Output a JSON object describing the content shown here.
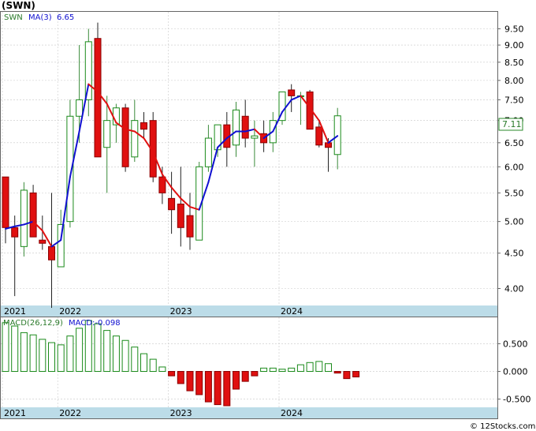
{
  "header": {
    "symbol": "(SWN)"
  },
  "price_legend": {
    "symbol": "SWN",
    "ma_label": "MA(3)",
    "ma_value": "6.65"
  },
  "macd_legend": {
    "label": "MACD(26,12,9)",
    "value_label": "MACD:-0.098"
  },
  "last_price_badge": "7.11",
  "watermark": "© 12Stocks.com",
  "colors": {
    "up": "#1a8a1a",
    "down": "#e01010",
    "ma_up": "#1010d0",
    "ma_down": "#e01010",
    "axis_band": "#bcdce8",
    "grid": "#c8c8c8"
  },
  "chart_data": [
    {
      "type": "candlestick",
      "title": "",
      "scale": "log",
      "y_ticks": [
        "9.50",
        "9.00",
        "8.50",
        "8.00",
        "7.50",
        "7.00",
        "6.50",
        "6.00",
        "5.50",
        "5.00",
        "4.50",
        "4.00"
      ],
      "x_tick_labels": [
        "2021",
        "2022",
        "2023",
        "2024"
      ],
      "x_tick_index": [
        0,
        6,
        18,
        30
      ],
      "ylim": [
        3.8,
        10.0
      ],
      "grid": true,
      "candles": [
        {
          "o": 5.8,
          "h": 5.8,
          "l": 4.65,
          "c": 4.9
        },
        {
          "o": 4.9,
          "h": 5.1,
          "l": 3.9,
          "c": 4.75
        },
        {
          "o": 4.6,
          "h": 5.7,
          "l": 4.45,
          "c": 5.55
        },
        {
          "o": 5.5,
          "h": 5.65,
          "l": 4.8,
          "c": 4.75
        },
        {
          "o": 4.7,
          "h": 5.1,
          "l": 4.55,
          "c": 4.65
        },
        {
          "o": 4.6,
          "h": 5.5,
          "l": 3.75,
          "c": 4.4
        },
        {
          "o": 4.3,
          "h": 5.2,
          "l": 4.3,
          "c": 4.95
        },
        {
          "o": 5.0,
          "h": 7.5,
          "l": 4.9,
          "c": 7.1
        },
        {
          "o": 7.1,
          "h": 9.0,
          "l": 6.5,
          "c": 7.5
        },
        {
          "o": 7.5,
          "h": 9.5,
          "l": 7.1,
          "c": 9.1
        },
        {
          "o": 9.2,
          "h": 9.7,
          "l": 6.2,
          "c": 6.2
        },
        {
          "o": 6.4,
          "h": 7.6,
          "l": 5.5,
          "c": 7.0
        },
        {
          "o": 6.9,
          "h": 7.4,
          "l": 6.5,
          "c": 7.3
        },
        {
          "o": 7.3,
          "h": 7.4,
          "l": 5.9,
          "c": 6.0
        },
        {
          "o": 6.2,
          "h": 7.5,
          "l": 6.1,
          "c": 7.0
        },
        {
          "o": 6.95,
          "h": 7.2,
          "l": 6.6,
          "c": 6.8
        },
        {
          "o": 7.0,
          "h": 7.2,
          "l": 5.7,
          "c": 5.8
        },
        {
          "o": 5.8,
          "h": 6.0,
          "l": 5.3,
          "c": 5.5
        },
        {
          "o": 5.4,
          "h": 5.9,
          "l": 4.8,
          "c": 5.2
        },
        {
          "o": 5.3,
          "h": 6.0,
          "l": 4.6,
          "c": 4.9
        },
        {
          "o": 5.1,
          "h": 5.5,
          "l": 4.55,
          "c": 4.75
        },
        {
          "o": 4.7,
          "h": 6.1,
          "l": 4.7,
          "c": 6.0
        },
        {
          "o": 6.0,
          "h": 6.9,
          "l": 5.9,
          "c": 6.6
        },
        {
          "o": 6.35,
          "h": 6.9,
          "l": 6.2,
          "c": 6.9
        },
        {
          "o": 6.9,
          "h": 7.2,
          "l": 6.0,
          "c": 6.4
        },
        {
          "o": 6.45,
          "h": 7.45,
          "l": 6.2,
          "c": 7.25
        },
        {
          "o": 7.1,
          "h": 7.5,
          "l": 6.4,
          "c": 6.6
        },
        {
          "o": 6.6,
          "h": 7.0,
          "l": 6.0,
          "c": 6.65
        },
        {
          "o": 6.7,
          "h": 7.0,
          "l": 6.3,
          "c": 6.5
        },
        {
          "o": 6.5,
          "h": 7.2,
          "l": 6.3,
          "c": 7.0
        },
        {
          "o": 7.0,
          "h": 7.7,
          "l": 6.9,
          "c": 7.7
        },
        {
          "o": 7.75,
          "h": 7.9,
          "l": 7.2,
          "c": 7.6
        },
        {
          "o": 7.6,
          "h": 7.7,
          "l": 6.9,
          "c": 7.6
        },
        {
          "o": 7.7,
          "h": 7.75,
          "l": 6.8,
          "c": 6.8
        },
        {
          "o": 6.85,
          "h": 7.0,
          "l": 6.4,
          "c": 6.45
        },
        {
          "o": 6.5,
          "h": 6.6,
          "l": 5.9,
          "c": 6.4
        },
        {
          "o": 6.25,
          "h": 7.3,
          "l": 5.95,
          "c": 7.11
        }
      ],
      "ma": [
        4.88,
        4.92,
        4.95,
        5.0,
        4.85,
        4.6,
        4.7,
        5.8,
        6.75,
        7.9,
        7.7,
        7.4,
        6.95,
        6.8,
        6.75,
        6.6,
        6.3,
        5.85,
        5.6,
        5.4,
        5.25,
        5.2,
        5.7,
        6.4,
        6.6,
        6.75,
        6.75,
        6.8,
        6.6,
        6.75,
        7.2,
        7.5,
        7.6,
        7.3,
        7.0,
        6.5,
        6.65
      ]
    },
    {
      "type": "bar",
      "title": "",
      "y_ticks": [
        "0.500",
        "0.000",
        "-0.500"
      ],
      "x_tick_labels": [
        "2021",
        "2022",
        "2023",
        "2024"
      ],
      "x_tick_index": [
        0,
        6,
        18,
        30
      ],
      "ylim": [
        -0.62,
        0.92
      ],
      "values": [
        0.88,
        0.82,
        0.7,
        0.66,
        0.58,
        0.52,
        0.48,
        0.64,
        0.78,
        0.92,
        0.86,
        0.74,
        0.64,
        0.56,
        0.44,
        0.32,
        0.22,
        0.08,
        -0.08,
        -0.22,
        -0.35,
        -0.42,
        -0.55,
        -0.6,
        -0.62,
        -0.32,
        -0.18,
        -0.08,
        0.06,
        0.06,
        0.04,
        0.06,
        0.12,
        0.16,
        0.18,
        0.14,
        -0.03,
        -0.13,
        -0.1
      ]
    }
  ]
}
